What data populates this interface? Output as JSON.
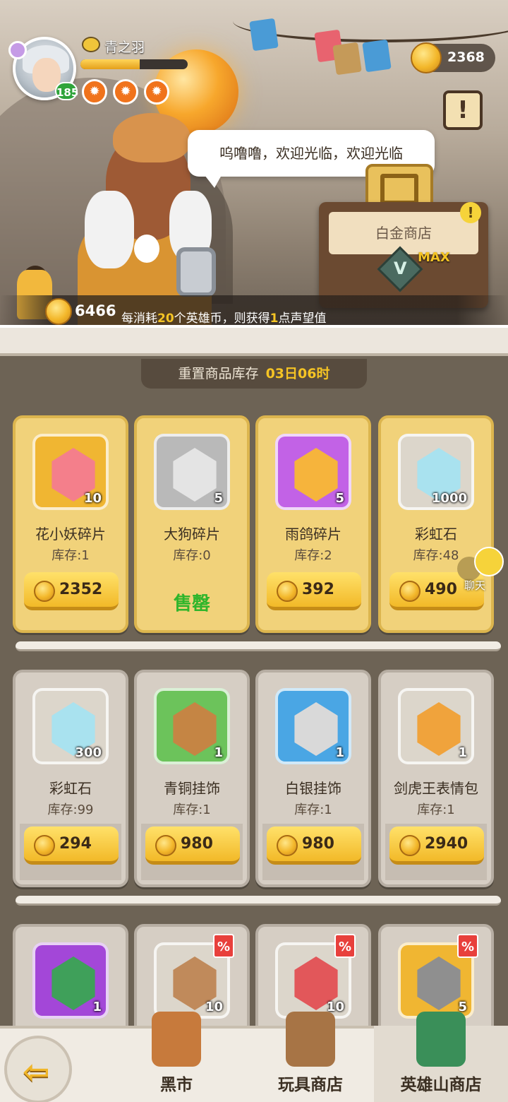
{
  "player": {
    "name": "青之羽",
    "level": "185",
    "xp_fraction": 0.55,
    "gold": "2368",
    "title_medals": [
      "fire-medal",
      "fire-medal",
      "fire-medal"
    ]
  },
  "npc": {
    "speech": "呜噜噜，欢迎光临，欢迎光临"
  },
  "shop_sign": {
    "name": "白金商店",
    "vip_letter": "V",
    "vip_max": "MAX"
  },
  "reputation": {
    "coins": "6466",
    "text_pre": "每消耗",
    "amount": "20",
    "text_mid": "个英雄币，则获得",
    "points": "1",
    "text_post": "点声望值"
  },
  "reset": {
    "label": "重置商品库存",
    "time": "03日06时"
  },
  "items": [
    {
      "name": "花小妖碎片",
      "stock": "库存:1",
      "qty": "10",
      "price": "2352",
      "sold_out": false,
      "frame": "gold",
      "icon_bg": "#f0b632",
      "glyph_color": "#f47f8b"
    },
    {
      "name": "大狗碎片",
      "stock": "库存:0",
      "qty": "5",
      "price": "",
      "sold_out": true,
      "sold_label": "售罄",
      "frame": "gold",
      "icon_bg": "#b9b9b9",
      "glyph_color": "#e4e4e4"
    },
    {
      "name": "雨鸽碎片",
      "stock": "库存:2",
      "qty": "5",
      "price": "392",
      "sold_out": false,
      "frame": "gold",
      "icon_bg": "#c262e6",
      "glyph_color": "#f6b43c"
    },
    {
      "name": "彩虹石",
      "stock": "库存:48",
      "qty": "1000",
      "price": "490",
      "sold_out": false,
      "frame": "gold",
      "icon_bg": "#dcd6cb",
      "glyph_color": "#a9e2ef"
    },
    {
      "name": "彩虹石",
      "stock": "库存:99",
      "qty": "300",
      "price": "294",
      "sold_out": false,
      "frame": "gray",
      "icon_bg": "#dcd6cb",
      "glyph_color": "#a9e2ef"
    },
    {
      "name": "青铜挂饰",
      "stock": "库存:1",
      "qty": "1",
      "price": "980",
      "sold_out": false,
      "frame": "gray",
      "icon_bg": "#6cc35b",
      "glyph_color": "#c58544"
    },
    {
      "name": "白银挂饰",
      "stock": "库存:1",
      "qty": "1",
      "price": "980",
      "sold_out": false,
      "frame": "gray",
      "icon_bg": "#4aa6e4",
      "glyph_color": "#d9d9d9"
    },
    {
      "name": "剑虎王表情包",
      "stock": "库存:1",
      "qty": "1",
      "price": "2940",
      "sold_out": false,
      "frame": "gray",
      "icon_bg": "#dcd6cb",
      "glyph_color": "#f0a33c"
    },
    {
      "qty": "1",
      "frame": "gray",
      "icon_bg": "#a347d8",
      "glyph_color": "#3fa05a",
      "discount": false
    },
    {
      "qty": "10",
      "frame": "gray",
      "icon_bg": "#dcd6cb",
      "glyph_color": "#c08a5b",
      "discount": true
    },
    {
      "qty": "10",
      "frame": "gray",
      "icon_bg": "#dcd6cb",
      "glyph_color": "#e2575a",
      "discount": true
    },
    {
      "qty": "5",
      "frame": "gray",
      "icon_bg": "#f0b632",
      "glyph_color": "#8f8f8f",
      "discount": true
    }
  ],
  "discount_symbol": "%",
  "chat": {
    "label": "聊天"
  },
  "nav": {
    "back_icon": "back-arrow-icon",
    "tabs": [
      "黑市",
      "玩具商店",
      "英雄山商店"
    ],
    "active_index": 2
  },
  "colors": {
    "accent_gold": "#f5c424",
    "sold_out_green": "#2fb52b",
    "level_green": "#2fa43b"
  }
}
